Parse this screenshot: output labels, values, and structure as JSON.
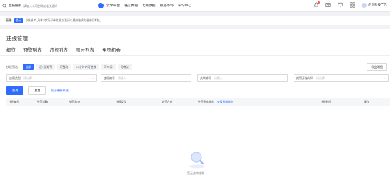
{
  "topbar": {
    "search_label": "直报搜索",
    "search_placeholder": "请输入公司名称或者关键词",
    "nav": [
      "云擎平台",
      "链信数据",
      "电商数据",
      "服务市场",
      "学习中心"
    ],
    "user": "佳恩科技广告"
  },
  "notice": {
    "title": "直播",
    "tag": "提示",
    "message": "仅供参考,具体以实际订单信息为准,请以最终结果为准进行考核。"
  },
  "page": {
    "title": "违规管理",
    "tabs": [
      "概览",
      "预警列表",
      "违规列表",
      "赔付列表",
      "免罚机会"
    ],
    "active_tab": 2
  },
  "quick": {
    "label": "快捷筛选",
    "pills": [
      "全部",
      "近7日判罚",
      "可整改",
      "24小时内可整改",
      "可申诉",
      "可考试"
    ],
    "active": 0
  },
  "export_label": "导出明细",
  "filters": [
    {
      "label": "违规类型",
      "placeholder": "请选择"
    },
    {
      "label": "违规编号",
      "placeholder": "请输入"
    },
    {
      "label": "关联编号",
      "placeholder": "请输入"
    },
    {
      "label": "处罚开始时间",
      "placeholder": "请选择"
    }
  ],
  "buttons": {
    "query": "查询",
    "reset": "重置",
    "more": "展开更多筛选"
  },
  "table": {
    "headers": [
      "违规编号",
      "处罚对象",
      "处罚状态",
      "违规类型",
      "处罚方式",
      "处罚影响状态",
      "违规时间",
      "操作"
    ],
    "header_link": "查看影响状态"
  },
  "empty_text": "暂无查询结果",
  "colors": {
    "accent": "#2f6bff",
    "notice_dot": "#ff4d4f"
  }
}
